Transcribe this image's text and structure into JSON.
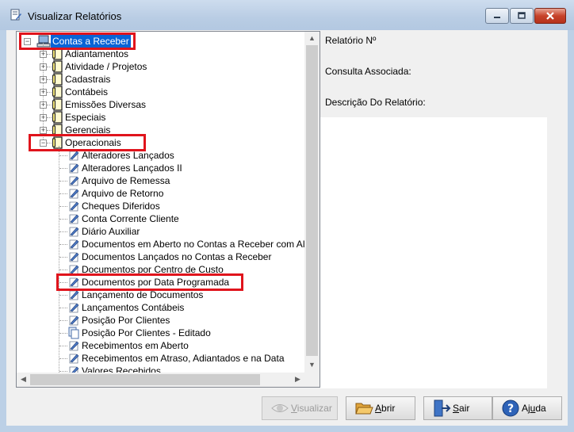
{
  "window": {
    "title": "Visualizar Relatórios"
  },
  "tree": {
    "root": {
      "label": "Contas a Receber",
      "icon": "computer-icon"
    },
    "groups": [
      {
        "label": "Adiantamentos",
        "icon": "folder-document-icon"
      },
      {
        "label": "Atividade / Projetos",
        "icon": "folder-document-icon"
      },
      {
        "label": "Cadastrais",
        "icon": "folder-document-icon"
      },
      {
        "label": "Contábeis",
        "icon": "folder-document-icon"
      },
      {
        "label": "Emissões Diversas",
        "icon": "folder-document-icon"
      },
      {
        "label": "Especiais",
        "icon": "folder-document-icon"
      },
      {
        "label": "Gerenciais",
        "icon": "folder-document-icon"
      },
      {
        "label": "Operacionais",
        "icon": "folder-document-icon"
      }
    ],
    "reports": [
      {
        "label": "Alteradores  Lançados",
        "icon": "report-pen-icon"
      },
      {
        "label": "Alteradores  Lançados II",
        "icon": "report-pen-icon"
      },
      {
        "label": "Arquivo de Remessa",
        "icon": "report-pen-icon"
      },
      {
        "label": "Arquivo de Retorno",
        "icon": "report-pen-icon"
      },
      {
        "label": "Cheques Diferidos",
        "icon": "report-pen-icon"
      },
      {
        "label": "Conta Corrente Cliente",
        "icon": "report-pen-icon"
      },
      {
        "label": "Diário  Auxiliar",
        "icon": "report-pen-icon"
      },
      {
        "label": "Documentos em Aberto no Contas a Receber com Alte",
        "icon": "report-pen-icon"
      },
      {
        "label": "Documentos Lançados no Contas a Receber",
        "icon": "report-pen-icon"
      },
      {
        "label": "Documentos por Centro de Custo",
        "icon": "report-pen-icon"
      },
      {
        "label": "Documentos por Data Programada",
        "icon": "report-pen-icon"
      },
      {
        "label": "Lançamento  de Documentos",
        "icon": "report-pen-icon"
      },
      {
        "label": "Lançamentos Contábeis",
        "icon": "report-pen-icon"
      },
      {
        "label": "Posição Por Clientes",
        "icon": "report-pen-icon"
      },
      {
        "label": "Posição Por Clientes - Editado",
        "icon": "document-copy-icon"
      },
      {
        "label": "Recebimentos em Aberto",
        "icon": "report-pen-icon"
      },
      {
        "label": "Recebimentos em Atraso, Adiantados e na Data",
        "icon": "report-pen-icon"
      },
      {
        "label": "Valores Recebidos",
        "icon": "report-pen-icon"
      }
    ]
  },
  "details": {
    "report_no_label": "Relatório Nº",
    "query_label": "Consulta Associada:",
    "description_label": "Descrição Do Relatório:"
  },
  "buttons": {
    "view": {
      "pre": "",
      "key": "V",
      "post": "isualizar",
      "enabled": false
    },
    "open": {
      "pre": "",
      "key": "A",
      "post": "brir",
      "enabled": true
    },
    "exit": {
      "pre": "",
      "key": "S",
      "post": "air",
      "enabled": true
    },
    "help": {
      "pre": "Aj",
      "key": "u",
      "post": "da",
      "enabled": true
    }
  },
  "colors": {
    "selection": "#0a64d6",
    "highlight": "#e0141c",
    "title_bar": "#b9cde4"
  }
}
